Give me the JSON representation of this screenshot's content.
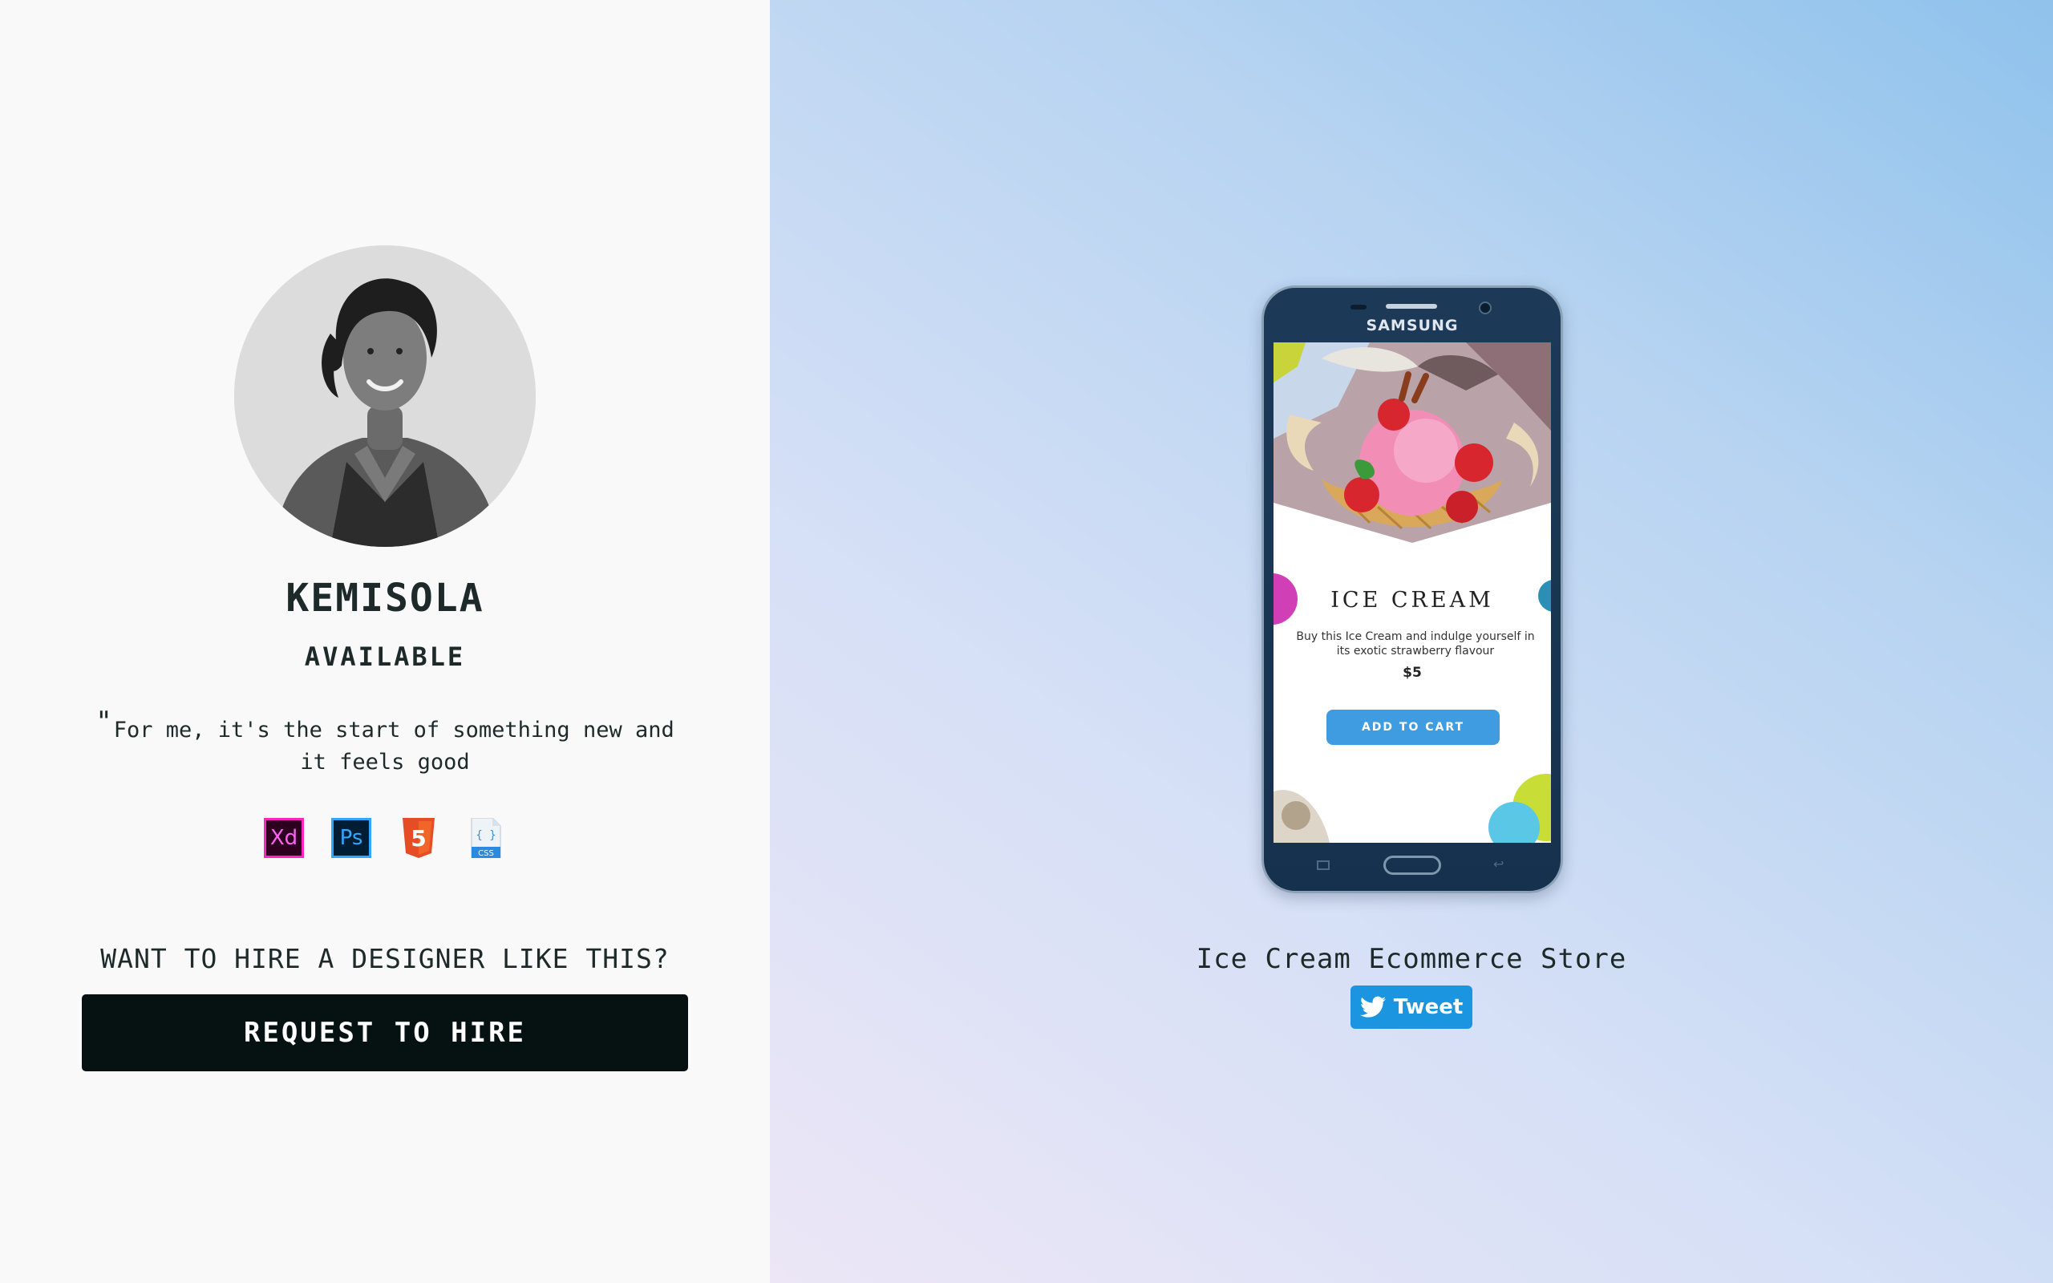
{
  "profile": {
    "name": "KEMISOLA",
    "status": "AVAILABLE",
    "quote_mark": "\"",
    "quote": "For me, it's the start of something new and it feels good",
    "tools": [
      {
        "label": "Xd",
        "icon": "adobe-xd-icon"
      },
      {
        "label": "Ps",
        "icon": "photoshop-icon"
      },
      {
        "label": "5",
        "icon": "html5-icon"
      },
      {
        "label": "{ }",
        "icon": "css-file-icon",
        "sub": "CSS"
      }
    ]
  },
  "hire": {
    "prompt": "WANT TO HIRE A DESIGNER LIKE THIS?",
    "button_label": "REQUEST TO HIRE"
  },
  "project": {
    "device_brand": "SAMSUNG",
    "screen": {
      "title": "ICE CREAM",
      "description": "Buy this Ice Cream and indulge yourself in its exotic strawberry flavour",
      "price": "$5",
      "cart_label": "ADD TO CART"
    },
    "title": "Ice Cream Ecommerce Store",
    "tweet_label": "Tweet"
  },
  "colors": {
    "left_background": "#f9f9f9",
    "hire_button": "#061211",
    "tweet_button": "#1b95e0",
    "cart_button": "#3f9ce0"
  }
}
